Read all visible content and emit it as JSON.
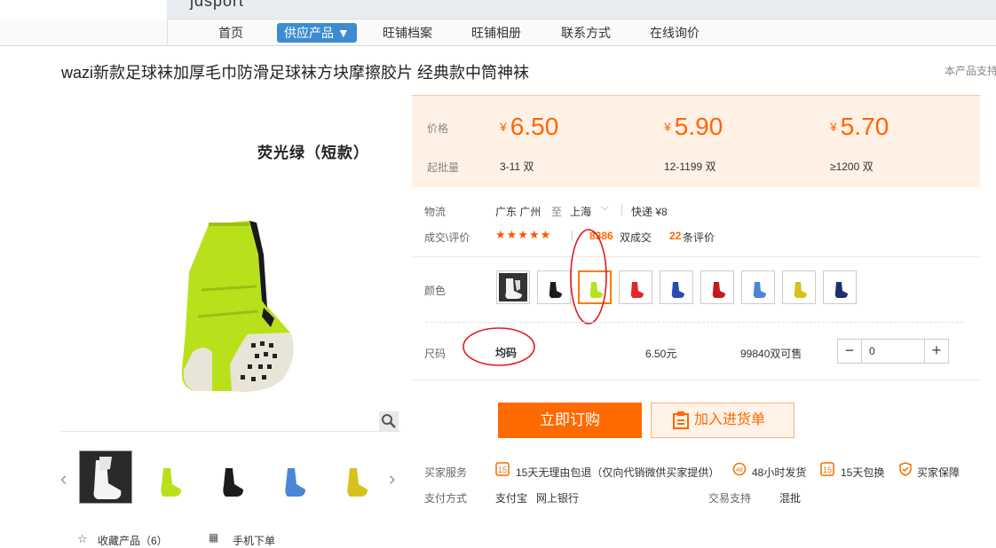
{
  "header": {
    "brand": "jdsport",
    "nav": [
      "首页",
      "供应产品 ▼",
      "旺铺档案",
      "旺铺相册",
      "联系方式",
      "在线询价"
    ]
  },
  "product": {
    "title": "wazi新款足球袜加厚毛巾防滑足球袜方块摩擦胶片 经典款中筒神袜",
    "side_note": "本产品支持",
    "image_caption": "荧光绿（短款）"
  },
  "price_panel": {
    "price_label": "价格",
    "moq_label": "起批量",
    "tiers": [
      {
        "currency": "¥",
        "price": "6.50",
        "range": "3-11 双"
      },
      {
        "currency": "¥",
        "price": "5.90",
        "range": "12-1199 双"
      },
      {
        "currency": "¥",
        "price": "5.70",
        "range": "≥1200 双"
      }
    ]
  },
  "logistics": {
    "label": "物流",
    "from": "广东 广州",
    "to_word": "至",
    "to": "上海",
    "express": "快递 ¥8"
  },
  "sales": {
    "label": "成交\\评价",
    "stars": "★★★★★",
    "deals_count": "8386",
    "deals_suffix": "双成交",
    "reviews_count": "22",
    "reviews_suffix": "条评价"
  },
  "color": {
    "label": "颜色",
    "swatches": [
      "white",
      "black",
      "green",
      "red",
      "blue",
      "red",
      "light-blue",
      "yellow",
      "navy"
    ],
    "selected_index": 2
  },
  "size": {
    "label": "尺码",
    "value": "均码",
    "price": "6.50元",
    "stock": "99840双可售",
    "quantity": "0",
    "minus": "−",
    "plus": "+"
  },
  "actions": {
    "buy": "立即订购",
    "cart": "加入进货单"
  },
  "services": {
    "label": "买家服务",
    "items": [
      "15天无理由包退（仅向代销微供买家提供）",
      "48小时发货",
      "15天包换",
      "买家保障"
    ]
  },
  "payment": {
    "label": "支付方式",
    "methods": "支付宝   网上银行",
    "trade_label": "交易支持",
    "trade_value": "混批"
  },
  "footer": {
    "favorite": "收藏产品（6）",
    "mobile": "手机下单"
  },
  "colors": {
    "accent": "#ff6600",
    "nav_active": "#3d8cd1",
    "price_bg": "#fff1e6",
    "sock_green": "#b8e11c"
  }
}
